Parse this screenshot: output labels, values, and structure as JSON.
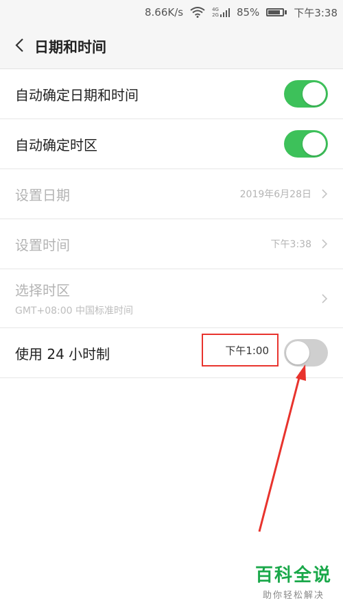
{
  "status_bar": {
    "speed": "8.66K/s",
    "network_top": "4G",
    "network_bottom": "2G",
    "battery": "85%",
    "battery_level": 0.85,
    "time": "下午3:38"
  },
  "header": {
    "title": "日期和时间",
    "back_icon": "chevron-left-icon"
  },
  "settings": {
    "auto_datetime": {
      "label": "自动确定日期和时间",
      "enabled": true
    },
    "auto_timezone": {
      "label": "自动确定时区",
      "enabled": true
    },
    "set_date": {
      "label": "设置日期",
      "value": "2019年6月28日"
    },
    "set_time": {
      "label": "设置时间",
      "value": "下午3:38"
    },
    "select_timezone": {
      "label": "选择时区",
      "sub": "GMT+08:00 中国标准时间"
    },
    "use_24h": {
      "label": "使用 24 小时制",
      "preview": "下午1:00",
      "enabled": false
    }
  },
  "annotation": {
    "box_color": "#e8332d",
    "arrow_color": "#e8332d"
  },
  "watermark": {
    "title": "百科全说",
    "subtitle": "助你轻松解决"
  },
  "colors": {
    "toggle_on": "#3dc15a",
    "toggle_off": "#cfcfcf",
    "brand": "#1aa84a"
  }
}
